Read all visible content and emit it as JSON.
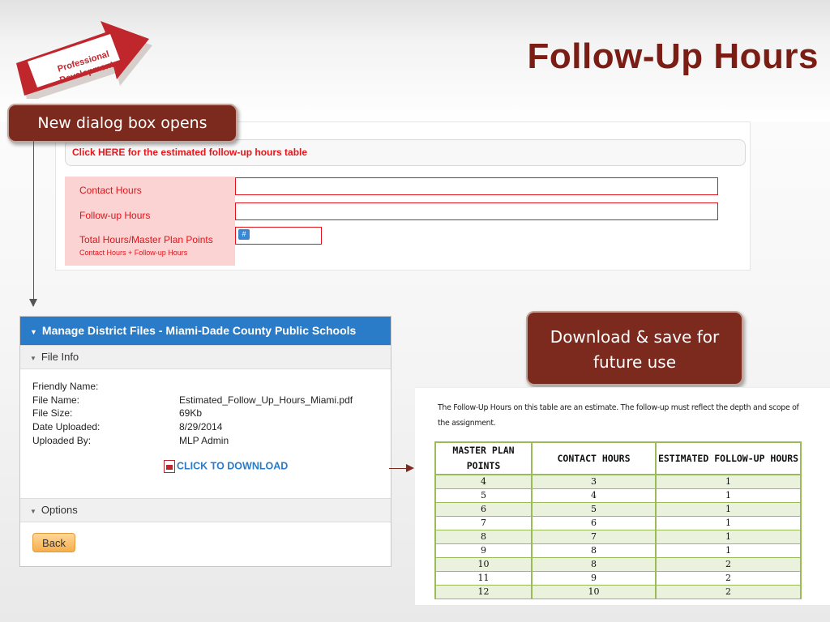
{
  "slide": {
    "title": "Follow-Up Hours",
    "logo_line1": "Professional",
    "logo_line2": "Development"
  },
  "callouts": {
    "dialog_opens": "New dialog box opens",
    "download_save": "Download & save for future use"
  },
  "form": {
    "click_here_text": "Click HERE for the estimated follow-up hours table",
    "contact_hours_label": "Contact Hours",
    "followup_hours_label": "Follow-up Hours",
    "total_hours_label": "Total Hours/Master Plan Points",
    "total_hours_sublabel": "Contact Hours + Follow-up Hours",
    "calc_icon_glyph": "#"
  },
  "dialog": {
    "header": "Manage District Files - Miami-Dade County Public Schools",
    "file_info_label": "File Info",
    "fields": [
      {
        "label": "Friendly Name:",
        "value": ""
      },
      {
        "label": "File Name:",
        "value": "Estimated_Follow_Up_Hours_Miami.pdf"
      },
      {
        "label": "File Size:",
        "value": "69Kb"
      },
      {
        "label": "Date Uploaded:",
        "value": "8/29/2014"
      },
      {
        "label": "Uploaded By:",
        "value": "MLP Admin"
      }
    ],
    "download_label": "CLICK TO DOWNLOAD",
    "options_label": "Options",
    "back_label": "Back"
  },
  "estimate_doc": {
    "note": "The Follow-Up Hours on this table are an estimate.  The follow-up must reflect the depth and scope of the assignment.",
    "headers": [
      "MASTER PLAN POINTS",
      "CONTACT HOURS",
      "ESTIMATED FOLLOW-UP HOURS"
    ],
    "rows": [
      [
        "4",
        "3",
        "1"
      ],
      [
        "5",
        "4",
        "1"
      ],
      [
        "6",
        "5",
        "1"
      ],
      [
        "7",
        "6",
        "1"
      ],
      [
        "8",
        "7",
        "1"
      ],
      [
        "9",
        "8",
        "1"
      ],
      [
        "10",
        "8",
        "2"
      ],
      [
        "11",
        "9",
        "2"
      ],
      [
        "12",
        "10",
        "2"
      ]
    ]
  },
  "colors": {
    "title": "#7a1d14",
    "callout_bg": "#7d2a1e",
    "form_red": "#e0141a",
    "label_bg": "#fbd3d3",
    "dialog_header": "#2a7cc8",
    "table_border": "#9bbb59",
    "table_alt_row": "#eaf1dd",
    "back_button": "#f6ae4b"
  }
}
